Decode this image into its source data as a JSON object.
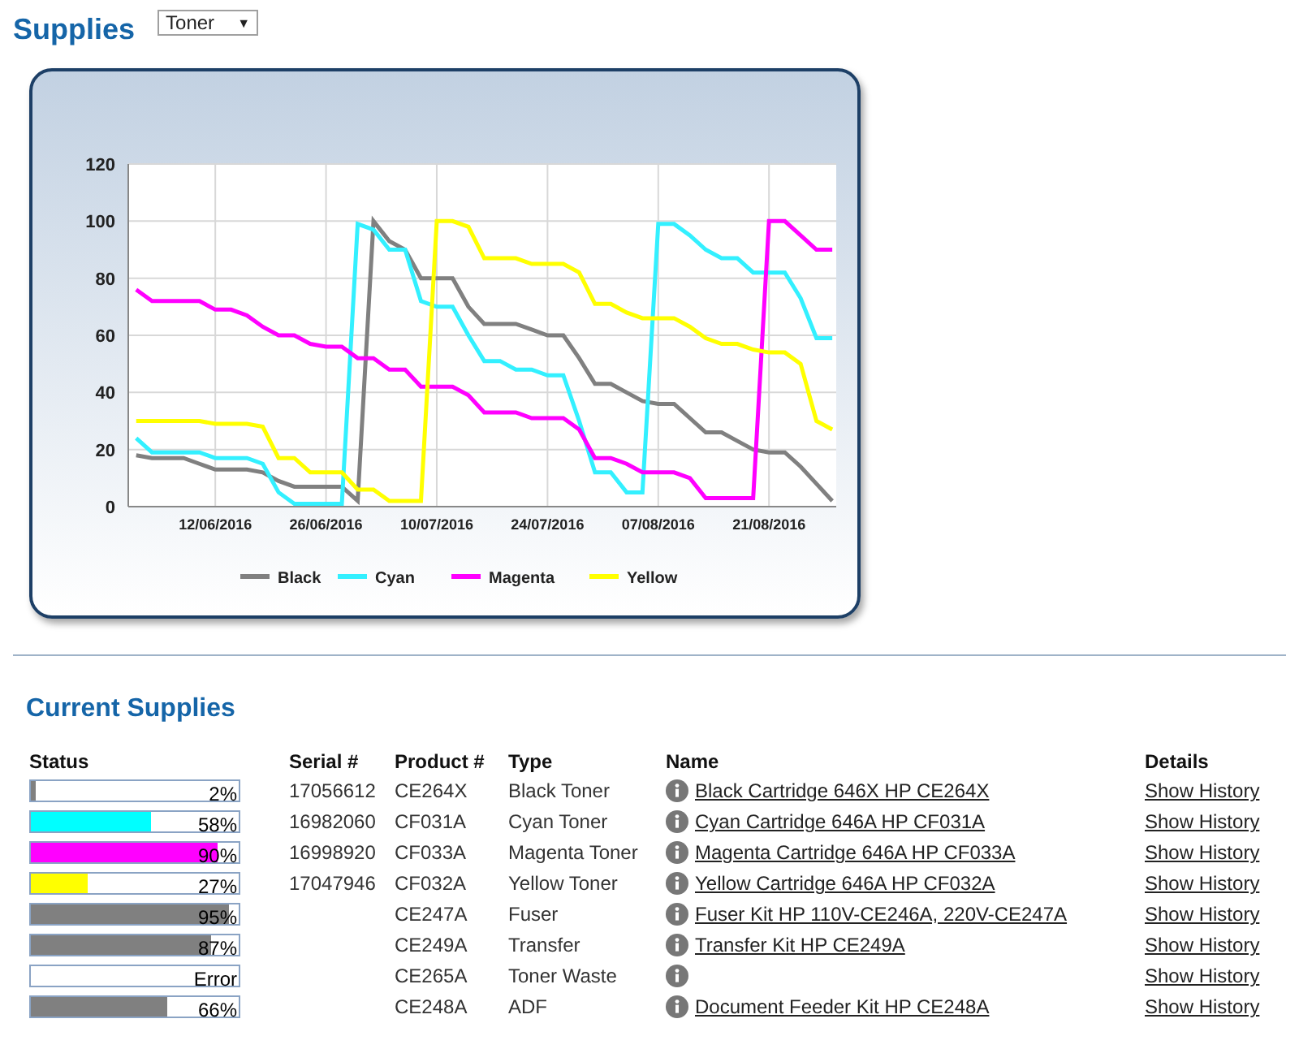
{
  "header": {
    "title": "Supplies",
    "filter": {
      "value": "Toner",
      "arrow": "▼"
    }
  },
  "usage_chart": {
    "chart_data": {
      "type": "line",
      "grid": true,
      "legend": "bottom",
      "ylim": [
        0,
        120
      ],
      "yticks": [
        0,
        20,
        40,
        60,
        80,
        100,
        120
      ],
      "categories": [
        null,
        null,
        null,
        null,
        null,
        "12/06/2016",
        null,
        null,
        null,
        null,
        null,
        null,
        "26/06/2016",
        null,
        null,
        null,
        null,
        null,
        null,
        "10/07/2016",
        null,
        null,
        null,
        null,
        null,
        null,
        "24/07/2016",
        null,
        null,
        null,
        null,
        null,
        null,
        "07/08/2016",
        null,
        null,
        null,
        null,
        null,
        null,
        "21/08/2016",
        null,
        null,
        null,
        null
      ],
      "series": [
        {
          "name": "Black",
          "color": "#808080",
          "values": [
            18,
            17,
            17,
            17,
            15,
            13,
            13,
            13,
            12,
            9,
            7,
            7,
            7,
            7,
            2,
            100,
            93,
            90,
            80,
            80,
            80,
            70,
            64,
            64,
            64,
            62,
            60,
            60,
            52,
            43,
            43,
            40,
            37,
            36,
            36,
            31,
            26,
            26,
            23,
            20,
            19,
            19,
            14,
            8,
            2
          ]
        },
        {
          "name": "Cyan",
          "color": "#33f0ff",
          "values": [
            24,
            19,
            19,
            19,
            19,
            17,
            17,
            17,
            15,
            5,
            1,
            1,
            1,
            1,
            99,
            97,
            90,
            90,
            72,
            70,
            70,
            60,
            51,
            51,
            48,
            48,
            46,
            46,
            30,
            12,
            12,
            5,
            5,
            99,
            99,
            95,
            90,
            87,
            87,
            82,
            82,
            82,
            73,
            59,
            59
          ]
        },
        {
          "name": "Magenta",
          "color": "#ff00ff",
          "values": [
            76,
            72,
            72,
            72,
            72,
            69,
            69,
            67,
            63,
            60,
            60,
            57,
            56,
            56,
            52,
            52,
            48,
            48,
            42,
            42,
            42,
            39,
            33,
            33,
            33,
            31,
            31,
            31,
            27,
            17,
            17,
            15,
            12,
            12,
            12,
            10,
            3,
            3,
            3,
            3,
            100,
            100,
            95,
            90,
            90
          ]
        },
        {
          "name": "Yellow",
          "color": "#ffff00",
          "values": [
            30,
            30,
            30,
            30,
            30,
            29,
            29,
            29,
            28,
            17,
            17,
            12,
            12,
            12,
            6,
            6,
            2,
            2,
            2,
            100,
            100,
            98,
            87,
            87,
            87,
            85,
            85,
            85,
            82,
            71,
            71,
            68,
            66,
            66,
            66,
            63,
            59,
            57,
            57,
            55,
            54,
            54,
            50,
            30,
            27
          ]
        }
      ]
    }
  },
  "current_supplies": {
    "title": "Current Supplies",
    "columns": [
      "Status",
      "Serial #",
      "Product #",
      "Type",
      "Name",
      "Details"
    ],
    "rows": [
      {
        "level": 0.02,
        "color": "#808080",
        "status": "2%",
        "serial": "17056612",
        "product": "CE264X",
        "type": "Black Toner",
        "name": "Black Cartridge 646X HP CE264X",
        "details": "Show History"
      },
      {
        "level": 0.58,
        "color": "#00ffff",
        "status": "58%",
        "serial": "16982060",
        "product": "CF031A",
        "type": "Cyan Toner",
        "name": "Cyan Cartridge 646A HP CF031A",
        "details": "Show History"
      },
      {
        "level": 0.9,
        "color": "#ff00ff",
        "status": "90%",
        "serial": "16998920",
        "product": "CF033A",
        "type": "Magenta Toner",
        "name": "Magenta Cartridge 646A HP CF033A",
        "details": "Show History"
      },
      {
        "level": 0.27,
        "color": "#ffff00",
        "status": "27%",
        "serial": "17047946",
        "product": "CF032A",
        "type": "Yellow Toner",
        "name": "Yellow Cartridge 646A HP CF032A",
        "details": "Show History"
      },
      {
        "level": 0.95,
        "color": "#808080",
        "status": "95%",
        "product": "CE247A",
        "type": "Fuser",
        "name": "Fuser Kit HP 110V-CE246A, 220V-CE247A",
        "details": "Show History"
      },
      {
        "level": 0.87,
        "color": "#808080",
        "status": "87%",
        "product": "CE249A",
        "type": "Transfer",
        "name": "Transfer Kit HP CE249A",
        "details": "Show History"
      },
      {
        "level": 0,
        "status": "Error",
        "product": "CE265A",
        "type": "Toner Waste",
        "details": "Show History"
      },
      {
        "level": 0.66,
        "color": "#808080",
        "status": "66%",
        "product": "CE248A",
        "type": "ADF",
        "name": "Document Feeder Kit HP CE248A",
        "details": "Show History"
      }
    ]
  }
}
